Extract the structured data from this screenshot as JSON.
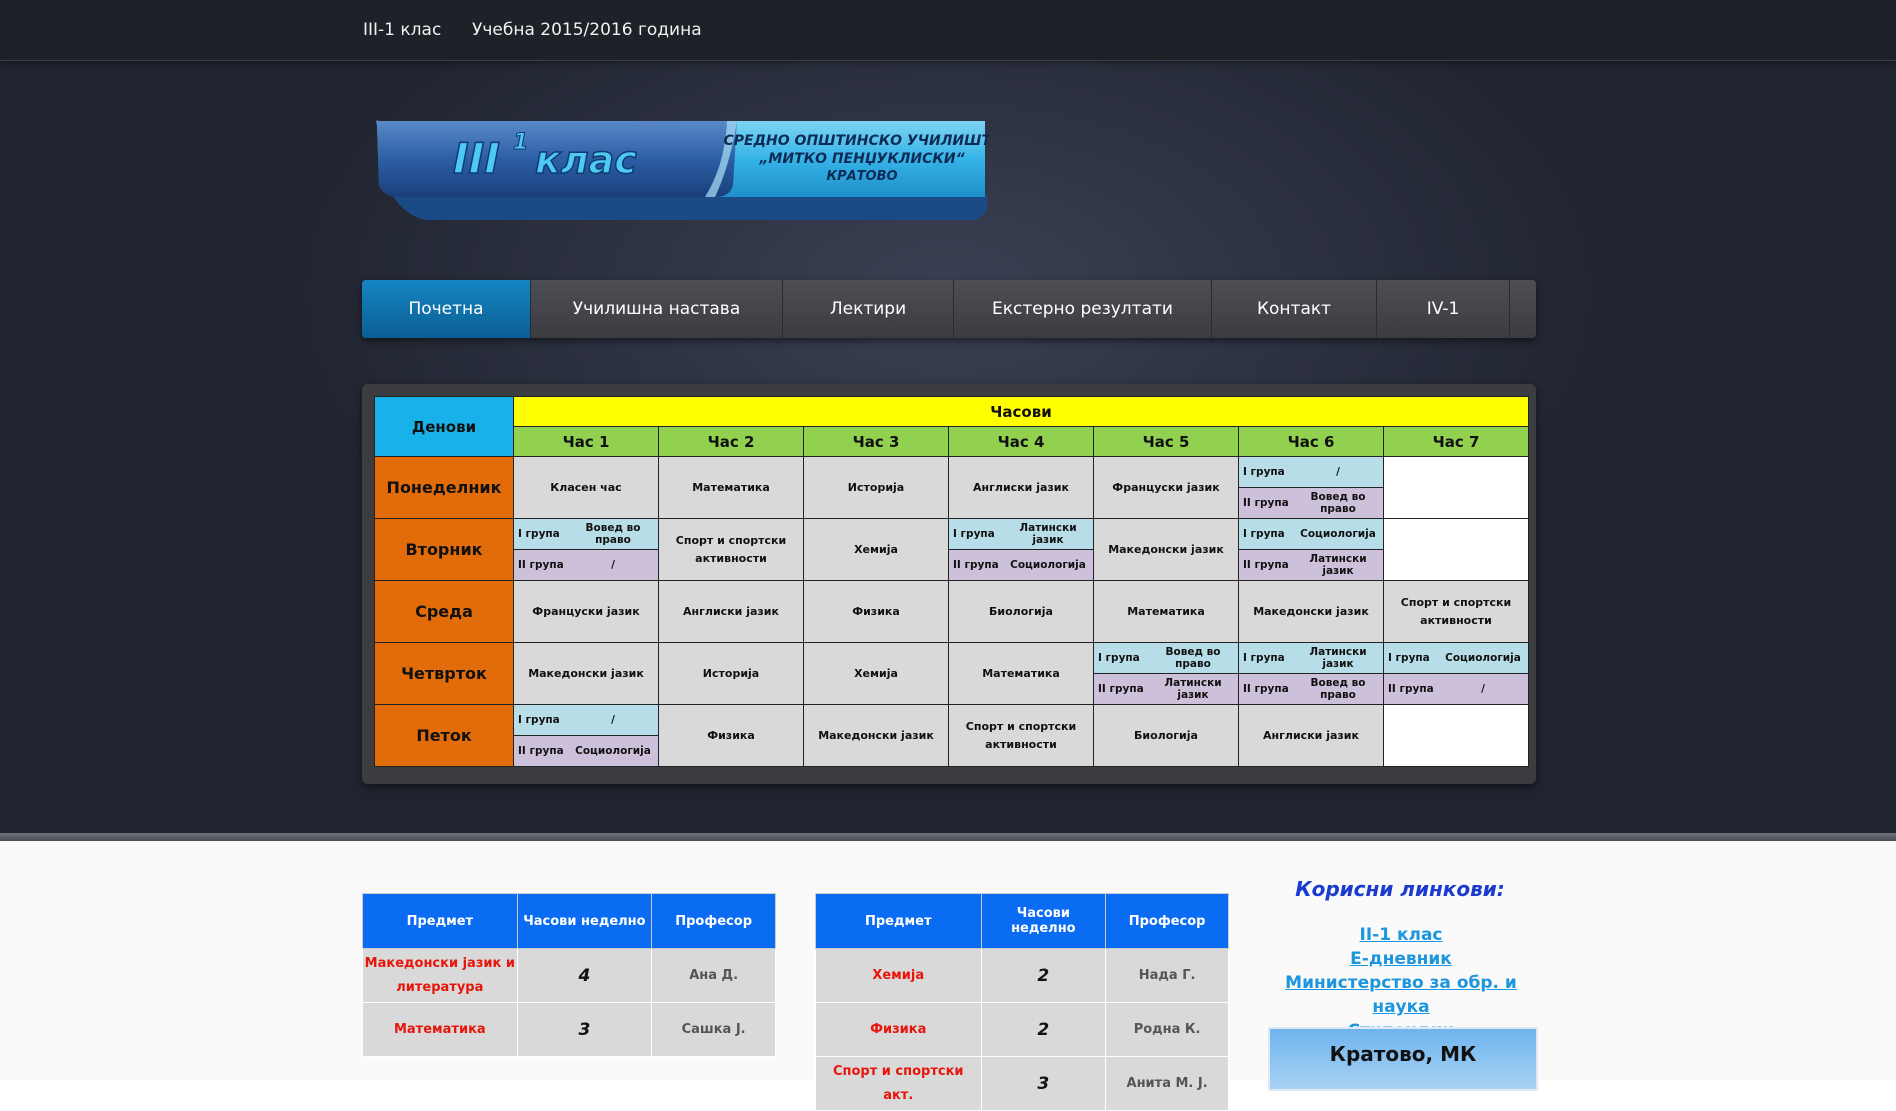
{
  "topbar": {
    "class_link": "III-1 клас",
    "year_link": "Учебна 2015/2016 година"
  },
  "logo": {
    "class_text": "III",
    "class_sup": "1",
    "class_word": "клас",
    "school_line1": "СРЕДНО ОПШТИНСКО УЧИЛИШТЕ",
    "school_line2": "„МИТКО ПЕНЏУКЛИСКИ“",
    "school_line3": "КРАТОВО"
  },
  "nav": {
    "items": [
      {
        "label": "Почетна",
        "active": true
      },
      {
        "label": "Училишна настава",
        "active": false
      },
      {
        "label": "Лектири",
        "active": false
      },
      {
        "label": "Екстерно резултати",
        "active": false
      },
      {
        "label": "Контакт",
        "active": false
      },
      {
        "label": "IV-1",
        "active": false
      }
    ]
  },
  "timetable": {
    "days_header": "Денови",
    "hours_header": "Часови",
    "hours": [
      "Час 1",
      "Час 2",
      "Час 3",
      "Час 4",
      "Час 5",
      "Час 6",
      "Час 7"
    ],
    "group1": "I група",
    "group2": "II група",
    "rows": [
      {
        "day": "Понеделник",
        "cells": [
          {
            "text": "Класен час"
          },
          {
            "text": "Математика"
          },
          {
            "text": "Историја"
          },
          {
            "text": "Англиски јазик"
          },
          {
            "text": "Француски јазик"
          },
          {
            "g1": "/",
            "g2": "Вовед во право"
          },
          {
            "text": "",
            "white": true
          }
        ]
      },
      {
        "day": "Вторник",
        "cells": [
          {
            "g1": "Вовед во право",
            "g2": "/"
          },
          {
            "text": "Спорт и спортски активности"
          },
          {
            "text": "Хемија"
          },
          {
            "g1": "Латински јазик",
            "g2": "Социологија"
          },
          {
            "text": "Македонски јазик"
          },
          {
            "g1": "Социологија",
            "g2": "Латински јазик"
          },
          {
            "text": "",
            "white": true
          }
        ]
      },
      {
        "day": "Среда",
        "cells": [
          {
            "text": "Француски јазик"
          },
          {
            "text": "Англиски јазик"
          },
          {
            "text": "Физика"
          },
          {
            "text": "Биологија"
          },
          {
            "text": "Математика"
          },
          {
            "text": "Македонски јазик"
          },
          {
            "text": "Спорт и спортски активности"
          }
        ]
      },
      {
        "day": "Четврток",
        "cells": [
          {
            "text": "Македонски јазик"
          },
          {
            "text": "Историја"
          },
          {
            "text": "Хемија"
          },
          {
            "text": "Математика"
          },
          {
            "g1": "Вовед во право",
            "g2": "Латински јазик"
          },
          {
            "g1": "Латински јазик",
            "g2": "Вовед во право"
          },
          {
            "g1": "Социологија",
            "g2": "/"
          }
        ]
      },
      {
        "day": "Петок",
        "cells": [
          {
            "g1": "/",
            "g2": "Социологија"
          },
          {
            "text": "Физика"
          },
          {
            "text": "Македонски јазик"
          },
          {
            "text": "Спорт и спортски активности"
          },
          {
            "text": "Биологија"
          },
          {
            "text": "Англиски јазик"
          },
          {
            "text": "",
            "white": true
          }
        ]
      }
    ]
  },
  "subjects_left": {
    "headers": [
      "Предмет",
      "Часови неделно",
      "Професор"
    ],
    "rows": [
      {
        "subject": "Македонски јазик и литература",
        "hours": "4",
        "prof": "Ана Д."
      },
      {
        "subject": "Математика",
        "hours": "3",
        "prof": "Сашка Ј."
      }
    ]
  },
  "subjects_right": {
    "headers": [
      "Предмет",
      "Часови неделно",
      "Професор"
    ],
    "rows": [
      {
        "subject": "Хемија",
        "hours": "2",
        "prof": "Нада Г."
      },
      {
        "subject": "Физика",
        "hours": "2",
        "prof": "Родна К."
      },
      {
        "subject": "Спорт и спортски акт.",
        "hours": "3",
        "prof": "Анита М. Ј."
      }
    ]
  },
  "links": {
    "title": "Корисни линкови:",
    "items": [
      "II-1 клас",
      "Е-дневник",
      "Министерство за обр. и наука",
      "Стипендии"
    ]
  },
  "weather": {
    "title": "Кратово, МК"
  }
}
